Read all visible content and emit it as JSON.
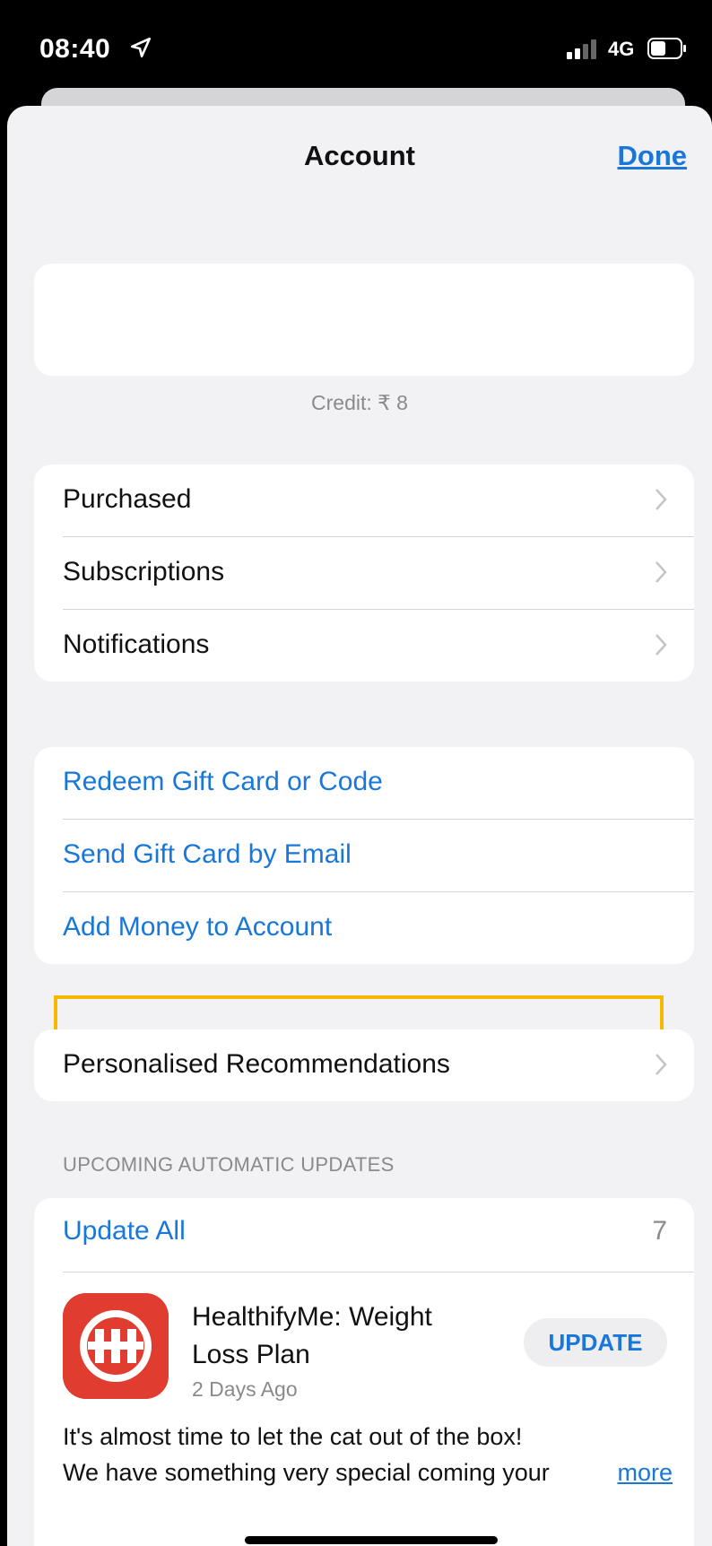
{
  "status_bar": {
    "time": "08:40",
    "network": "4G"
  },
  "nav": {
    "title": "Account",
    "done_label": "Done"
  },
  "credit": "Credit: ₹ 8",
  "menu1": [
    {
      "label": "Purchased"
    },
    {
      "label": "Subscriptions"
    },
    {
      "label": "Notifications"
    }
  ],
  "menu2": [
    {
      "label": "Redeem Gift Card or Code"
    },
    {
      "label": "Send Gift Card by Email"
    },
    {
      "label": "Add Money to Account"
    }
  ],
  "menu3": [
    {
      "label": "Personalised Recommendations"
    }
  ],
  "updates": {
    "section_header": "UPCOMING AUTOMATIC UPDATES",
    "update_all_label": "Update All",
    "count": "7",
    "app": {
      "name": "HealthifyMe: Weight Loss Plan",
      "date": "2 Days Ago",
      "update_label": "UPDATE",
      "notes_line1": "It's almost time to let the cat out of the box!",
      "notes_line2": "We have something very special coming your",
      "more_label": "more"
    }
  },
  "colors": {
    "accent": "#1877d9",
    "highlight": "#f5b800",
    "app_icon": "#e03c2f"
  },
  "icons": [
    "location-arrow-icon",
    "signal-icon",
    "battery-icon",
    "chevron-right-icon",
    "healthifyme-app-icon"
  ]
}
